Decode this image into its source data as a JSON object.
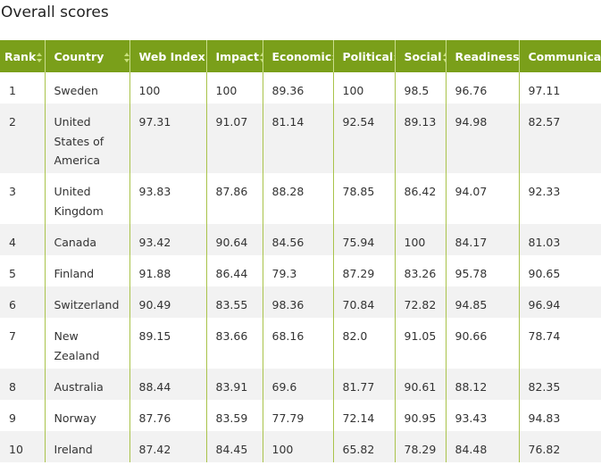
{
  "page": {
    "title": "Overall scores"
  },
  "table": {
    "columns": [
      "Rank",
      "Country",
      "Web Index",
      "Impact",
      "Economic",
      "Political",
      "Social",
      "Readiness",
      "Communications"
    ],
    "rows": [
      {
        "rank": "1",
        "country": "Sweden",
        "web_index": "100",
        "impact": "100",
        "economic": "89.36",
        "political": "100",
        "social": "98.5",
        "readiness": "96.76",
        "communications": "97.11"
      },
      {
        "rank": "2",
        "country": "United States of America",
        "web_index": "97.31",
        "impact": "91.07",
        "economic": "81.14",
        "political": "92.54",
        "social": "89.13",
        "readiness": "94.98",
        "communications": "82.57"
      },
      {
        "rank": "3",
        "country": "United Kingdom",
        "web_index": "93.83",
        "impact": "87.86",
        "economic": "88.28",
        "political": "78.85",
        "social": "86.42",
        "readiness": "94.07",
        "communications": "92.33"
      },
      {
        "rank": "4",
        "country": "Canada",
        "web_index": "93.42",
        "impact": "90.64",
        "economic": "84.56",
        "political": "75.94",
        "social": "100",
        "readiness": "84.17",
        "communications": "81.03"
      },
      {
        "rank": "5",
        "country": "Finland",
        "web_index": "91.88",
        "impact": "86.44",
        "economic": "79.3",
        "political": "87.29",
        "social": "83.26",
        "readiness": "95.78",
        "communications": "90.65"
      },
      {
        "rank": "6",
        "country": "Switzerland",
        "web_index": "90.49",
        "impact": "83.55",
        "economic": "98.36",
        "political": "70.84",
        "social": "72.82",
        "readiness": "94.85",
        "communications": "96.94"
      },
      {
        "rank": "7",
        "country": "New Zealand",
        "web_index": "89.15",
        "impact": "83.66",
        "economic": "68.16",
        "political": "82.0",
        "social": "91.05",
        "readiness": "90.66",
        "communications": "78.74"
      },
      {
        "rank": "8",
        "country": "Australia",
        "web_index": "88.44",
        "impact": "83.91",
        "economic": "69.6",
        "political": "81.77",
        "social": "90.61",
        "readiness": "88.12",
        "communications": "82.35"
      },
      {
        "rank": "9",
        "country": "Norway",
        "web_index": "87.76",
        "impact": "83.59",
        "economic": "77.79",
        "political": "72.14",
        "social": "90.95",
        "readiness": "93.43",
        "communications": "94.83"
      },
      {
        "rank": "10",
        "country": "Ireland",
        "web_index": "87.42",
        "impact": "84.45",
        "economic": "100",
        "political": "65.82",
        "social": "78.29",
        "readiness": "84.48",
        "communications": "76.82"
      }
    ]
  },
  "colors": {
    "header_bg": "#7a9f1a",
    "header_text": "#ffffff",
    "row_alt_bg": "#f2f2f2",
    "column_divider": "#a9c34a"
  }
}
